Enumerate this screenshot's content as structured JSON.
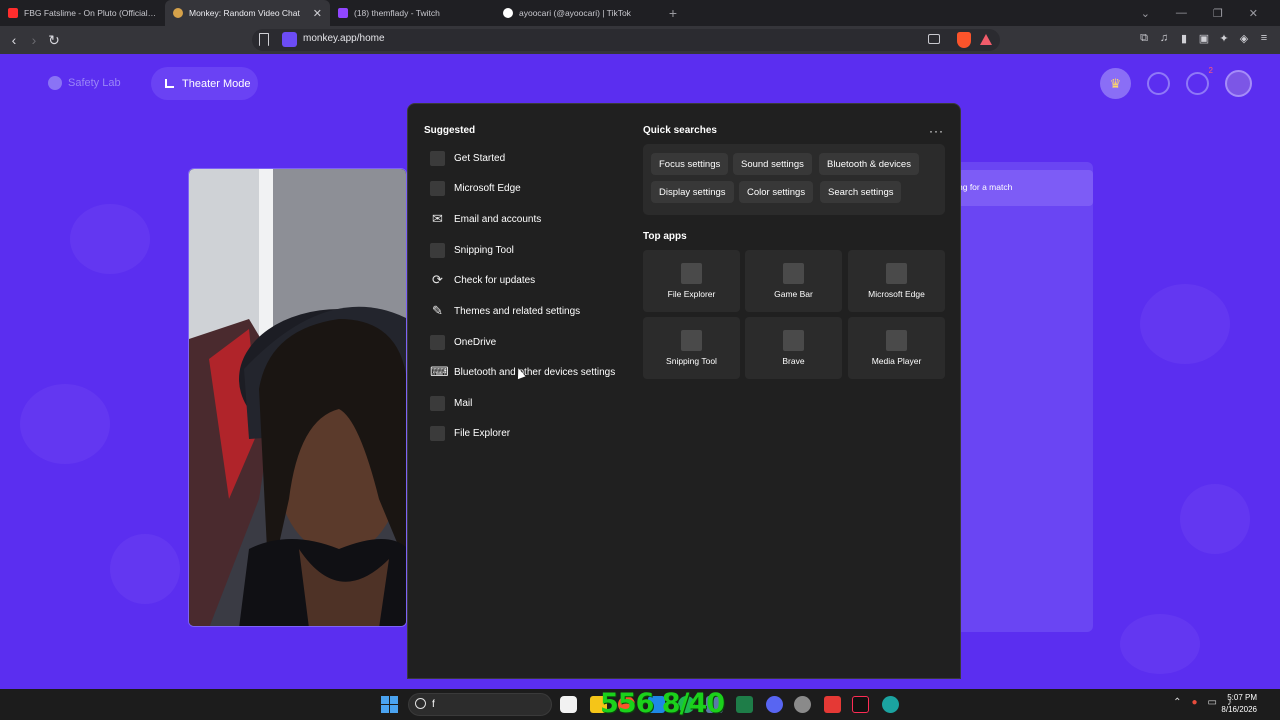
{
  "browser": {
    "tabs": [
      {
        "title": "FBG Fatslime - On Pluto (Official Mu",
        "color": "#ff2d2d",
        "active": false
      },
      {
        "title": "Monkey: Random Video Chat",
        "color": "#d6a24a",
        "active": true
      },
      {
        "title": "(18) themflady - Twitch",
        "color": "#9146ff",
        "active": false
      },
      {
        "title": "ayoocari (@ayoocari) | TikTok",
        "color": "#ffffff",
        "active": false
      }
    ],
    "new_tab": "+",
    "url": "monkey.app/home"
  },
  "page": {
    "safety_lab": "Safety Lab",
    "theater_mode": "Theater Mode",
    "match_status": "ng for a match",
    "notification_count": "2"
  },
  "start_search": {
    "suggested_title": "Suggested",
    "suggested": [
      {
        "label": "Get Started",
        "icon": "app-placeholder-icon"
      },
      {
        "label": "Microsoft Edge",
        "icon": "app-placeholder-icon"
      },
      {
        "label": "Email and accounts",
        "icon": "mail-icon"
      },
      {
        "label": "Snipping Tool",
        "icon": "app-placeholder-icon"
      },
      {
        "label": "Check for updates",
        "icon": "refresh-icon"
      },
      {
        "label": "Themes and related settings",
        "icon": "pen-icon"
      },
      {
        "label": "OneDrive",
        "icon": "app-placeholder-icon"
      },
      {
        "label": "Bluetooth and other devices settings",
        "icon": "devices-icon"
      },
      {
        "label": "Mail",
        "icon": "app-placeholder-icon"
      },
      {
        "label": "File Explorer",
        "icon": "app-placeholder-icon"
      }
    ],
    "quick_searches_title": "Quick searches",
    "more": "···",
    "quick_searches": [
      "Focus settings",
      "Sound settings",
      "Bluetooth & devices",
      "Display settings",
      "Color settings",
      "Search settings"
    ],
    "top_apps_title": "Top apps",
    "top_apps": [
      "File Explorer",
      "Game Bar",
      "Microsoft Edge",
      "Snipping Tool",
      "Brave",
      "Media Player"
    ]
  },
  "taskbar": {
    "search_text": "f",
    "overlay_counter": "556 8/40",
    "time": "5:07 PM",
    "date": "8/16/2026"
  }
}
